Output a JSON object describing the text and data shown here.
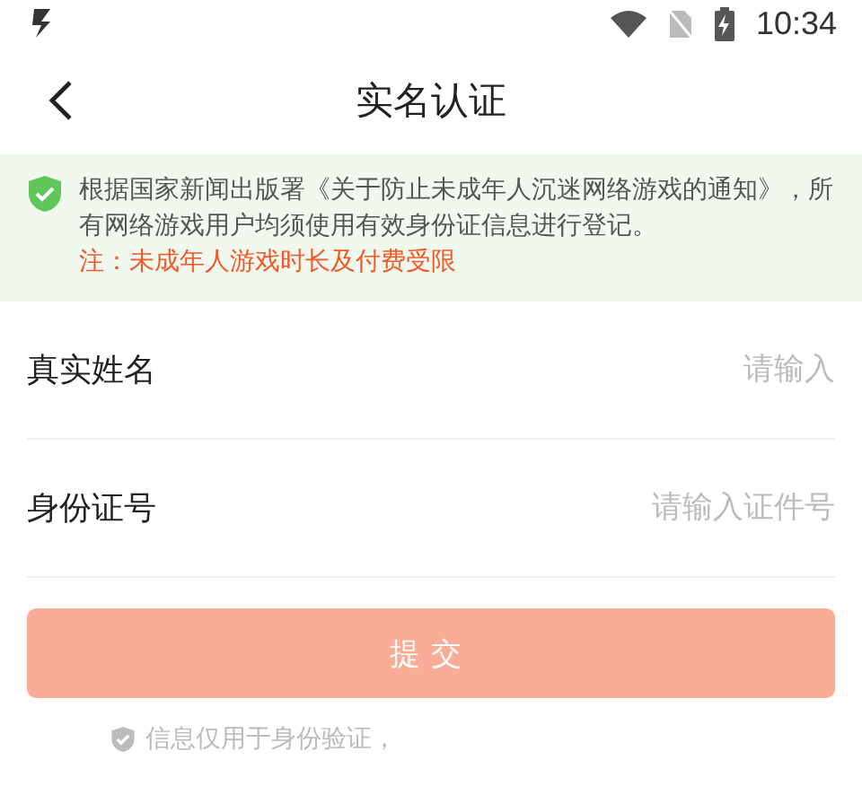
{
  "status_bar": {
    "time": "10:34"
  },
  "header": {
    "title": "实名认证"
  },
  "notice": {
    "text": "根据国家新闻出版署《关于防止未成年人沉迷网络游戏的通知》，所有网络游戏用户均须使用有效身份证信息进行登记。",
    "warning": "注：未成年人游戏时长及付费受限"
  },
  "fields": [
    {
      "label": "真实姓名",
      "placeholder": "请输入"
    },
    {
      "label": "身份证号",
      "placeholder": "请输入证件号"
    }
  ],
  "submit": {
    "label": "提交",
    "disabled": true
  },
  "footer": {
    "text": "信息仅用于身份验证，"
  }
}
